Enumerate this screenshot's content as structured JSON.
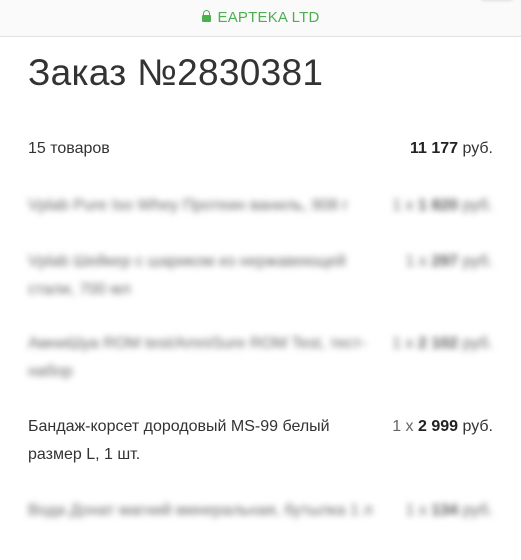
{
  "browser": {
    "site_name": "EAPTEKA LTD"
  },
  "order": {
    "title": "Заказ №2830381",
    "count_label": "15 товаров",
    "total_amount": "11 177",
    "total_currency": "руб."
  },
  "items": [
    {
      "name": "Vplab Pure Iso Whey Протеин ваниль, 908 г",
      "qty": "1 x",
      "amount": "1 820",
      "currency": "руб.",
      "blurred": true
    },
    {
      "name": "Vplab Шейкер с шариком из нержавеющей стали, 700 мл",
      "qty": "1 x",
      "amount": "297",
      "currency": "руб.",
      "blurred": true
    },
    {
      "name": "АмниШуа ROM test/AmniSure ROM Test, тест-набор",
      "qty": "1 x",
      "amount": "2 102",
      "currency": "руб.",
      "blurred": true
    },
    {
      "name": "Бандаж-корсет дородовый MS-99 белый размер L, 1 шт.",
      "qty": "1 x",
      "amount": "2 999",
      "currency": "руб.",
      "blurred": false
    },
    {
      "name": "Вода Донат магний минеральная, бутылка 1 л",
      "qty": "1 x",
      "amount": "134",
      "currency": "руб.",
      "blurred": true
    }
  ]
}
